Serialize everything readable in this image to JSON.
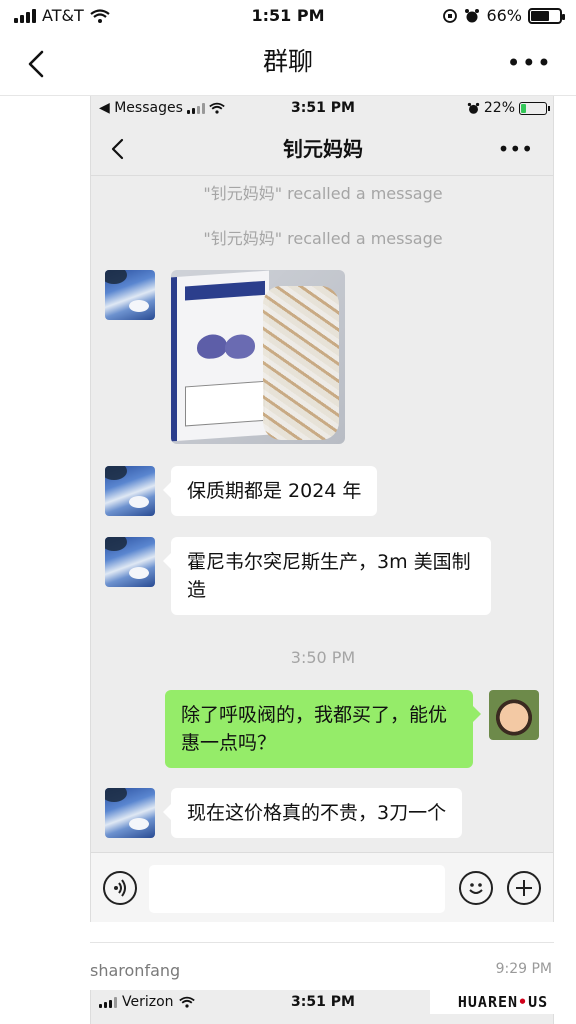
{
  "status_bar": {
    "carrier": "AT&T",
    "time": "1:51 PM",
    "battery": "66%",
    "battery_level": 0.66
  },
  "nav": {
    "title": "群聊",
    "more": "•••"
  },
  "inner": {
    "status": {
      "back_app": "◀ Messages",
      "time": "3:51 PM",
      "battery": "22%",
      "battery_level": 0.22
    },
    "nav": {
      "title": "钊元妈妈",
      "more": "•••"
    },
    "system_messages": [
      "\"钊元妈妈\" recalled a message",
      "\"钊元妈妈\" recalled a message"
    ],
    "messages": [
      {
        "text": "保质期都是 2024 年"
      },
      {
        "text": "霍尼韦尔突尼斯生产，3m 美国制造"
      },
      {
        "text": "除了呼吸阀的，我都买了，能优惠一点吗？"
      },
      {
        "text": "现在这价格真的不贵，3刀一个"
      }
    ],
    "timestamp": "3:50 PM"
  },
  "post": {
    "username": "sharonfang",
    "time": "9:29 PM"
  },
  "inner2": {
    "carrier": "Verizon",
    "time": "3:51 PM"
  },
  "watermark": {
    "brand": "HUAREN",
    "dot": "•",
    "tld": "US"
  }
}
